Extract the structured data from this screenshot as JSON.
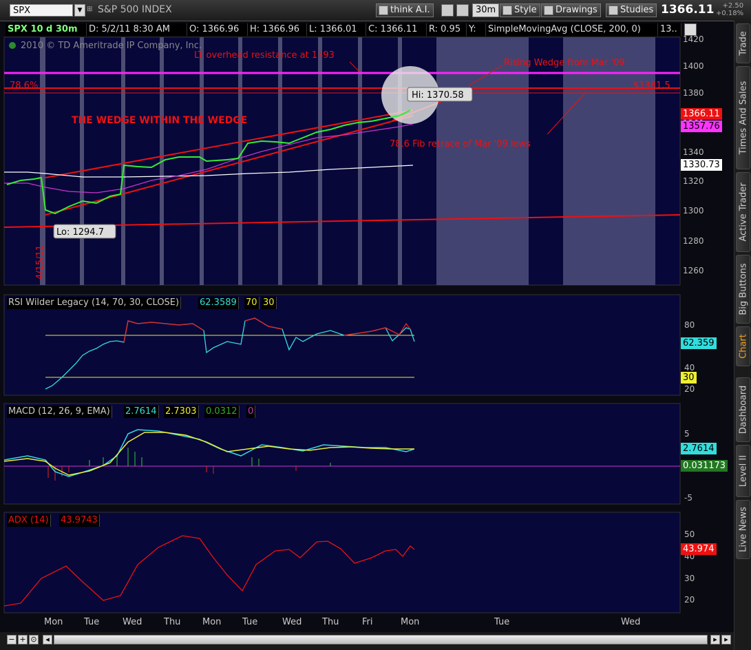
{
  "toolbar": {
    "symbol": "SPX",
    "index_name": "S&P 500 INDEX",
    "think_ai": "think A.I.",
    "timeframe": "30m",
    "style": "Style",
    "drawings": "Drawings",
    "studies": "Studies",
    "last_price": "1366.11",
    "change": "+2.50",
    "change_pct": "+0.18%"
  },
  "chart_header": {
    "title": "SPX 10 d 30m",
    "date": "D: 5/2/11 8:30 AM",
    "open": "O: 1366.96",
    "high": "H: 1366.96",
    "low": "L: 1366.01",
    "close": "C: 1366.11",
    "range": "R: 0.95",
    "y": "Y:",
    "study": "SimpleMovingAvg (CLOSE, 200, 0)",
    "study_more": "13.."
  },
  "copyright": "2010 © TD Ameritrade IP Company, Inc.",
  "annotations": {
    "lt_resistance": "LT overhead resistance at 1393",
    "rising_wedge": "Rising Wedge from Mar '09",
    "fib_level": "78.6%",
    "fib_price": "$1381.5",
    "wedge_title": "THE WEDGE WITHIN THE WEDGE",
    "fib_retrace": "78.6 Fib retrace of Mar '09 lows",
    "hi_label": "Hi: 1370.58",
    "lo_label": "Lo: 1294.7",
    "date_mark": "4/15/11"
  },
  "price_axis": [
    "1420",
    "1400",
    "1380",
    "1360",
    "1340",
    "1320",
    "1300",
    "1280",
    "1260"
  ],
  "price_tags": {
    "last": "1366.11",
    "sma50": "1357.76",
    "sma200": "1330.73"
  },
  "rsi": {
    "name": "RSI Wilder Legacy (14, 70, 30, CLOSE)",
    "value": "62.3589",
    "ob": "70",
    "os": "30",
    "axis": [
      "80",
      "60",
      "40",
      "20"
    ],
    "tag_value": "62.359",
    "tag_os": "30"
  },
  "macd": {
    "name": "MACD (12, 26, 9, EMA)",
    "value": "2.7614",
    "avg": "2.7303",
    "diff": "0.0312",
    "zero": "0",
    "axis": [
      "5",
      "-5"
    ],
    "tag_value": "2.7614",
    "tag_diff": "0.031173"
  },
  "adx": {
    "name": "ADX (14)",
    "value": "43.9743",
    "axis": [
      "50",
      "40",
      "30",
      "20"
    ],
    "tag_value": "43.974"
  },
  "x_axis": [
    "Mon",
    "Tue",
    "Wed",
    "Thu",
    "Mon",
    "Tue",
    "Wed",
    "Thu",
    "Fri",
    "Mon",
    "Tue",
    "Wed"
  ],
  "sidebar_tabs": [
    "Trade",
    "Times And Sales",
    "Active Trader",
    "Big Buttons",
    "Chart",
    "Dashboard",
    "Level II",
    "Live News"
  ],
  "colors": {
    "bg_plot": "#07073a",
    "magenta_line": "#ff22ff",
    "red_line": "#ee1111",
    "rsi_line": "#33dddd",
    "macd_line": "#33dddd",
    "macd_avg": "#eeee33",
    "adx_line": "#ee1111"
  }
}
